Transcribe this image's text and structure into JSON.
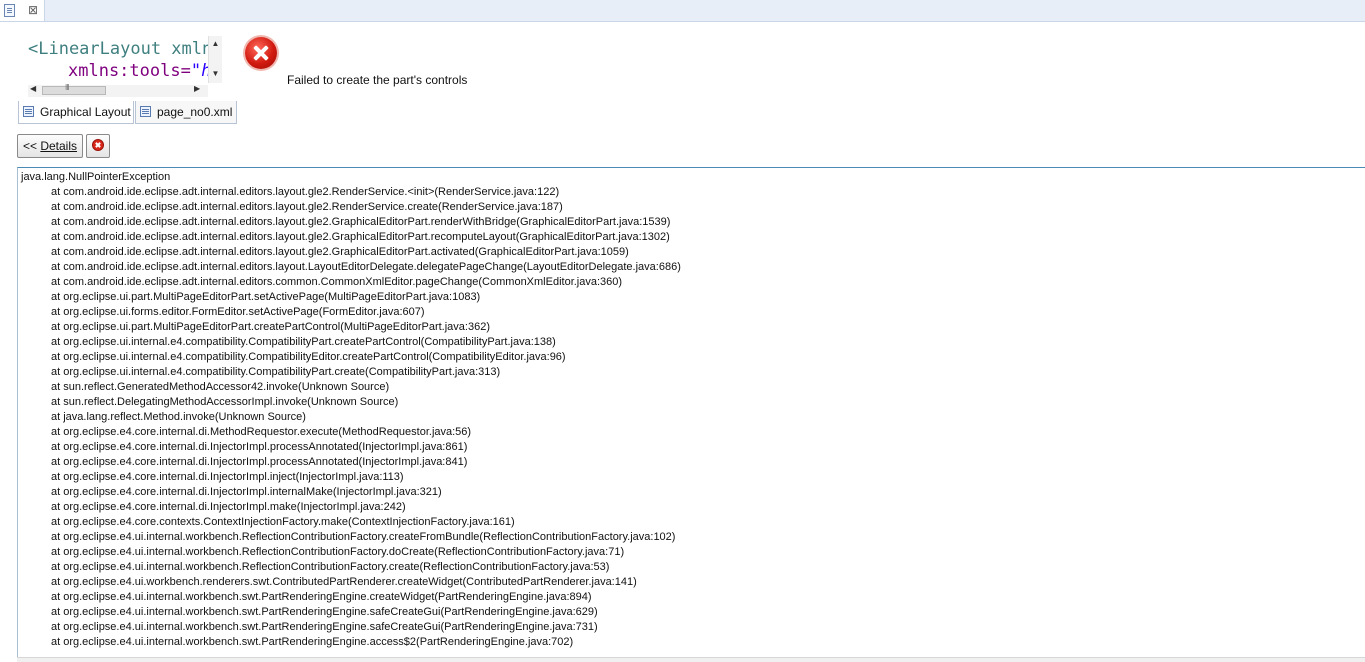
{
  "icons": {
    "editor_file": "file-icon",
    "editor_close": "close-icon",
    "error": "error-icon",
    "graphical_layout": "layout-icon",
    "xml_file": "xml-file-icon",
    "clear": "clear-icon"
  },
  "editor_tab": {
    "close_glyph": "⊠"
  },
  "code_preview": {
    "line1": "<LinearLayout xmln",
    "line2_attr": "xmlns:tools=",
    "line2_value": "\"h"
  },
  "subtabs": [
    {
      "label": "Graphical Layout"
    },
    {
      "label": "page_no0.xml"
    }
  ],
  "error": {
    "message": "Failed to create the part's controls"
  },
  "details_button": {
    "prefix": "<< ",
    "label": "Details"
  },
  "trace": {
    "exception": "java.lang.NullPointerException",
    "frames": [
      "at com.android.ide.eclipse.adt.internal.editors.layout.gle2.RenderService.<init>(RenderService.java:122)",
      "at com.android.ide.eclipse.adt.internal.editors.layout.gle2.RenderService.create(RenderService.java:187)",
      "at com.android.ide.eclipse.adt.internal.editors.layout.gle2.GraphicalEditorPart.renderWithBridge(GraphicalEditorPart.java:1539)",
      "at com.android.ide.eclipse.adt.internal.editors.layout.gle2.GraphicalEditorPart.recomputeLayout(GraphicalEditorPart.java:1302)",
      "at com.android.ide.eclipse.adt.internal.editors.layout.gle2.GraphicalEditorPart.activated(GraphicalEditorPart.java:1059)",
      "at com.android.ide.eclipse.adt.internal.editors.layout.LayoutEditorDelegate.delegatePageChange(LayoutEditorDelegate.java:686)",
      "at com.android.ide.eclipse.adt.internal.editors.common.CommonXmlEditor.pageChange(CommonXmlEditor.java:360)",
      "at org.eclipse.ui.part.MultiPageEditorPart.setActivePage(MultiPageEditorPart.java:1083)",
      "at org.eclipse.ui.forms.editor.FormEditor.setActivePage(FormEditor.java:607)",
      "at org.eclipse.ui.part.MultiPageEditorPart.createPartControl(MultiPageEditorPart.java:362)",
      "at org.eclipse.ui.internal.e4.compatibility.CompatibilityPart.createPartControl(CompatibilityPart.java:138)",
      "at org.eclipse.ui.internal.e4.compatibility.CompatibilityEditor.createPartControl(CompatibilityEditor.java:96)",
      "at org.eclipse.ui.internal.e4.compatibility.CompatibilityPart.create(CompatibilityPart.java:313)",
      "at sun.reflect.GeneratedMethodAccessor42.invoke(Unknown Source)",
      "at sun.reflect.DelegatingMethodAccessorImpl.invoke(Unknown Source)",
      "at java.lang.reflect.Method.invoke(Unknown Source)",
      "at org.eclipse.e4.core.internal.di.MethodRequestor.execute(MethodRequestor.java:56)",
      "at org.eclipse.e4.core.internal.di.InjectorImpl.processAnnotated(InjectorImpl.java:861)",
      "at org.eclipse.e4.core.internal.di.InjectorImpl.processAnnotated(InjectorImpl.java:841)",
      "at org.eclipse.e4.core.internal.di.InjectorImpl.inject(InjectorImpl.java:113)",
      "at org.eclipse.e4.core.internal.di.InjectorImpl.internalMake(InjectorImpl.java:321)",
      "at org.eclipse.e4.core.internal.di.InjectorImpl.make(InjectorImpl.java:242)",
      "at org.eclipse.e4.core.contexts.ContextInjectionFactory.make(ContextInjectionFactory.java:161)",
      "at org.eclipse.e4.ui.internal.workbench.ReflectionContributionFactory.createFromBundle(ReflectionContributionFactory.java:102)",
      "at org.eclipse.e4.ui.internal.workbench.ReflectionContributionFactory.doCreate(ReflectionContributionFactory.java:71)",
      "at org.eclipse.e4.ui.internal.workbench.ReflectionContributionFactory.create(ReflectionContributionFactory.java:53)",
      "at org.eclipse.e4.ui.workbench.renderers.swt.ContributedPartRenderer.createWidget(ContributedPartRenderer.java:141)",
      "at org.eclipse.e4.ui.internal.workbench.swt.PartRenderingEngine.createWidget(PartRenderingEngine.java:894)",
      "at org.eclipse.e4.ui.internal.workbench.swt.PartRenderingEngine.safeCreateGui(PartRenderingEngine.java:629)",
      "at org.eclipse.e4.ui.internal.workbench.swt.PartRenderingEngine.safeCreateGui(PartRenderingEngine.java:731)",
      "at org.eclipse.e4.ui.internal.workbench.swt.PartRenderingEngine.access$2(PartRenderingEngine.java:702)"
    ]
  }
}
